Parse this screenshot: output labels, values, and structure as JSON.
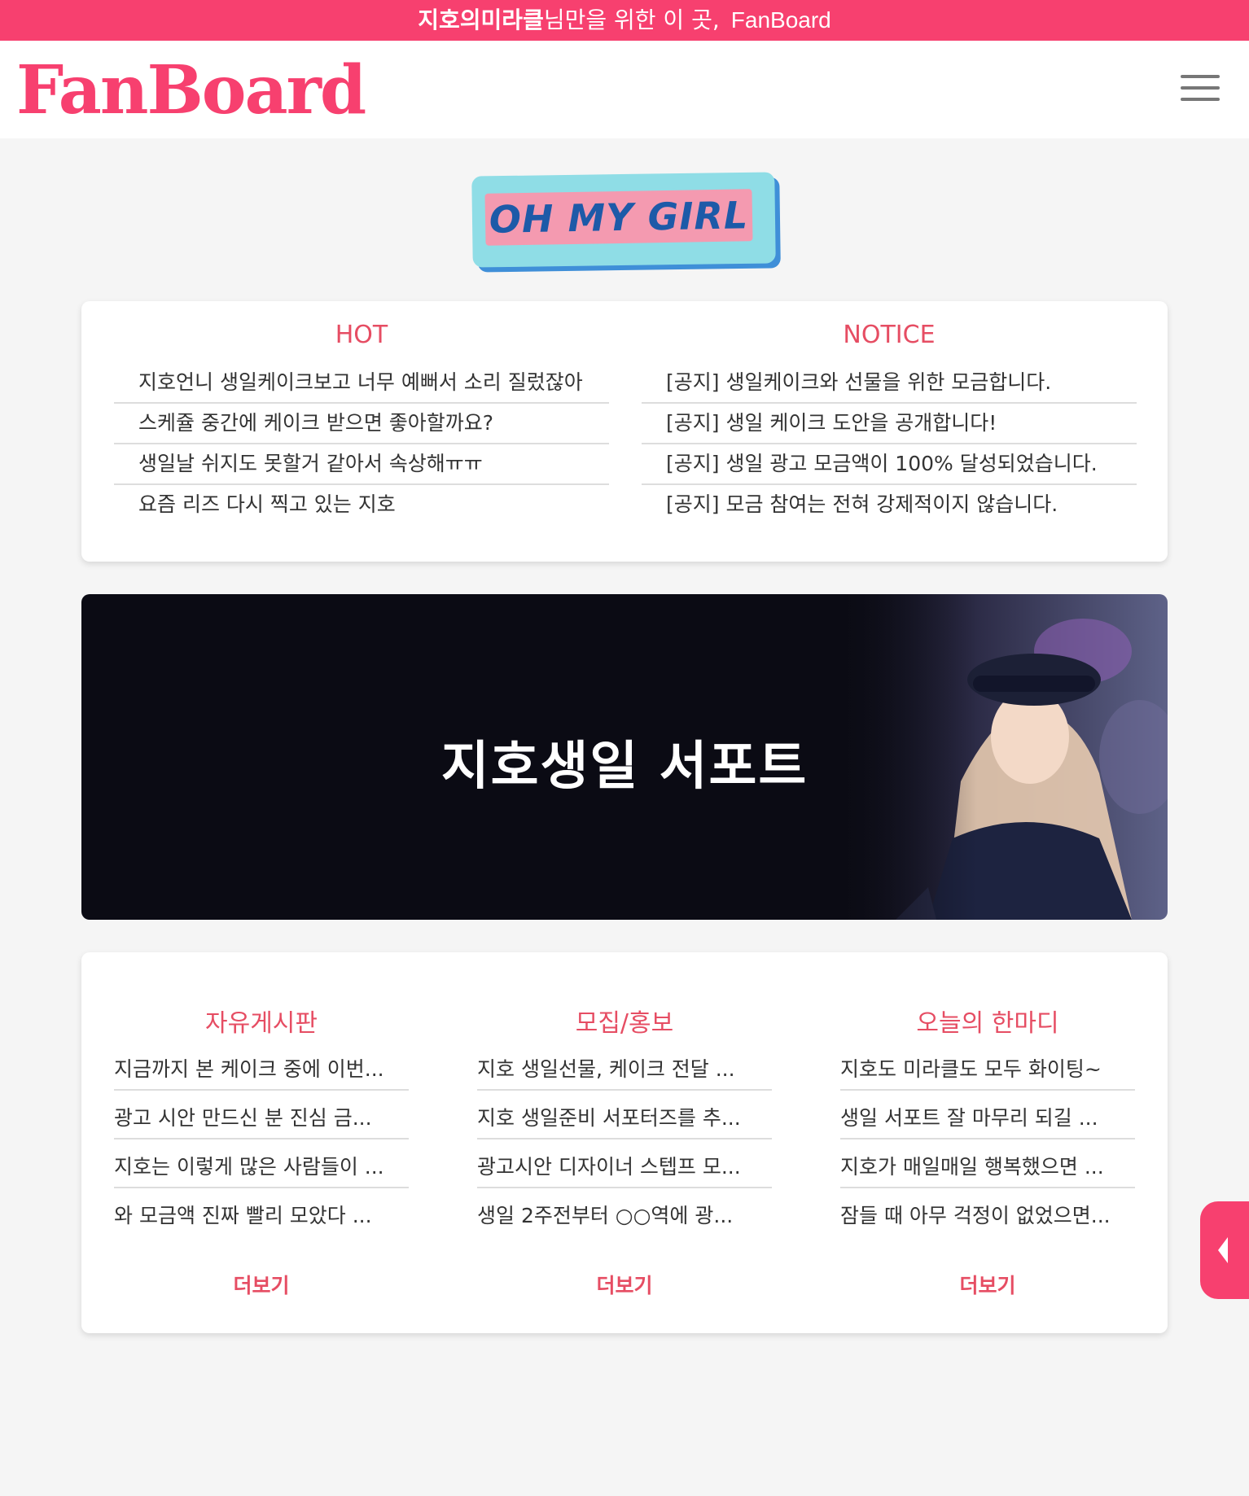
{
  "topbar": {
    "name": "지호의미라클",
    "text": "님만을 위한 이 곳,",
    "brand": "FanBoard"
  },
  "header": {
    "logo": "FanBoard"
  },
  "group_logo": {
    "text": "OH MY GIRL"
  },
  "hot": {
    "title": "HOT",
    "items": [
      "지호언니 생일케이크보고 너무 예뻐서 소리 질렀잖아",
      "스케쥴 중간에 케이크 받으면 좋아할까요?",
      "생일날 쉬지도 못할거 같아서 속상해ㅠㅠ",
      "요즘 리즈 다시 찍고 있는 지호"
    ]
  },
  "notice": {
    "title": "NOTICE",
    "items": [
      "[공지] 생일케이크와 선물을 위한 모금합니다.",
      "[공지] 생일 케이크 도안을 공개합니다!",
      "[공지] 생일 광고 모금액이 100% 달성되었습니다.",
      "[공지] 모금 참여는 전혀 강제적이지 않습니다."
    ]
  },
  "banner": {
    "title": "지호생일 서포트"
  },
  "boards": [
    {
      "title": "자유게시판",
      "items": [
        "지금까지 본 케이크 중에 이번...",
        "광고 시안 만드신 분 진심 금...",
        "지호는 이렇게 많은 사람들이 ...",
        "와 모금액 진짜 빨리 모았다 ..."
      ],
      "more": "더보기"
    },
    {
      "title": "모집/홍보",
      "items": [
        "지호 생일선물, 케이크 전달 ...",
        "지호 생일준비 서포터즈를 추...",
        "광고시안 디자이너 스텝프 모...",
        "생일 2주전부터 ○○역에 광..."
      ],
      "more": "더보기"
    },
    {
      "title": "오늘의 한마디",
      "items": [
        "지호도 미라클도 모두 화이팅~",
        "생일 서포트 잘 마무리 되길 ...",
        "지호가 매일매일 행복했으면 ...",
        "잠들 때 아무 걱정이 없었으면..."
      ],
      "more": "더보기"
    }
  ],
  "icons": {
    "menu": "hamburger-menu-icon",
    "side": "chevron-left-icon"
  },
  "colors": {
    "accent": "#f7406f",
    "title": "#e64d63",
    "banner_bg": "#0b0b14"
  }
}
